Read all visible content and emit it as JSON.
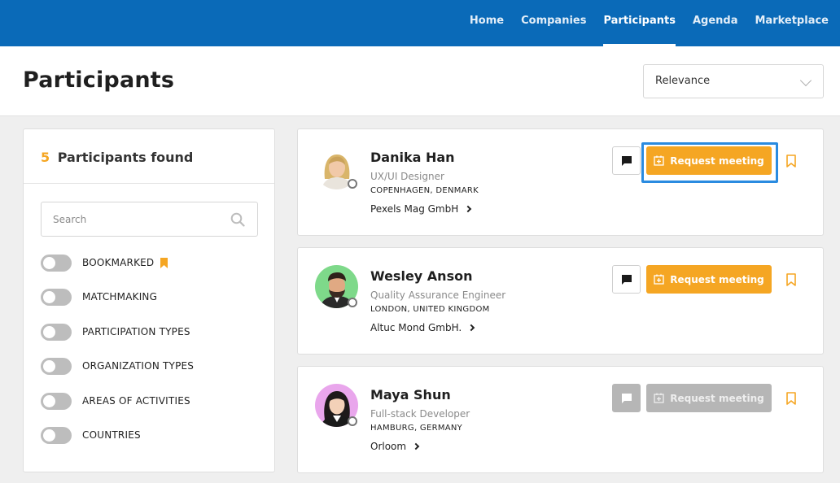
{
  "nav": {
    "items": [
      {
        "label": "Home",
        "active": false
      },
      {
        "label": "Companies",
        "active": false
      },
      {
        "label": "Participants",
        "active": true
      },
      {
        "label": "Agenda",
        "active": false
      },
      {
        "label": "Marketplace",
        "active": false
      }
    ]
  },
  "header": {
    "title": "Participants",
    "sort_value": "Relevance"
  },
  "filters": {
    "count": "5",
    "found_label": "Participants found",
    "search_placeholder": "Search",
    "toggles": [
      {
        "label": "BOOKMARKED",
        "on": false,
        "icon": "bookmark-icon"
      },
      {
        "label": "MATCHMAKING",
        "on": false
      },
      {
        "label": "PARTICIPATION TYPES",
        "on": false
      },
      {
        "label": "ORGANIZATION TYPES",
        "on": false
      },
      {
        "label": "AREAS OF ACTIVITIES",
        "on": false
      },
      {
        "label": "COUNTRIES",
        "on": false
      }
    ]
  },
  "participants": [
    {
      "name": "Danika Han",
      "role": "UX/UI Designer",
      "location": "COPENHAGEN, DENMARK",
      "company": "Pexels Mag GmbH",
      "request_label": "Request meeting",
      "enabled": true,
      "focused": true,
      "avatar_bg": "#ffffff"
    },
    {
      "name": "Wesley Anson",
      "role": "Quality Assurance Engineer",
      "location": "LONDON, UNITED KINGDOM",
      "company": "Altuc Mond GmbH.",
      "request_label": "Request meeting",
      "enabled": true,
      "focused": false,
      "avatar_bg": "#7ed98a"
    },
    {
      "name": "Maya Shun",
      "role": "Full-stack Developer",
      "location": "HAMBURG, GERMANY",
      "company": "Orloom",
      "request_label": "Request meeting",
      "enabled": false,
      "focused": false,
      "avatar_bg": "#e9a6ec"
    }
  ],
  "colors": {
    "brand": "#0a6ab8",
    "accent": "#f5a623",
    "focus": "#2a8be0",
    "disabled": "#b6b6b6"
  }
}
